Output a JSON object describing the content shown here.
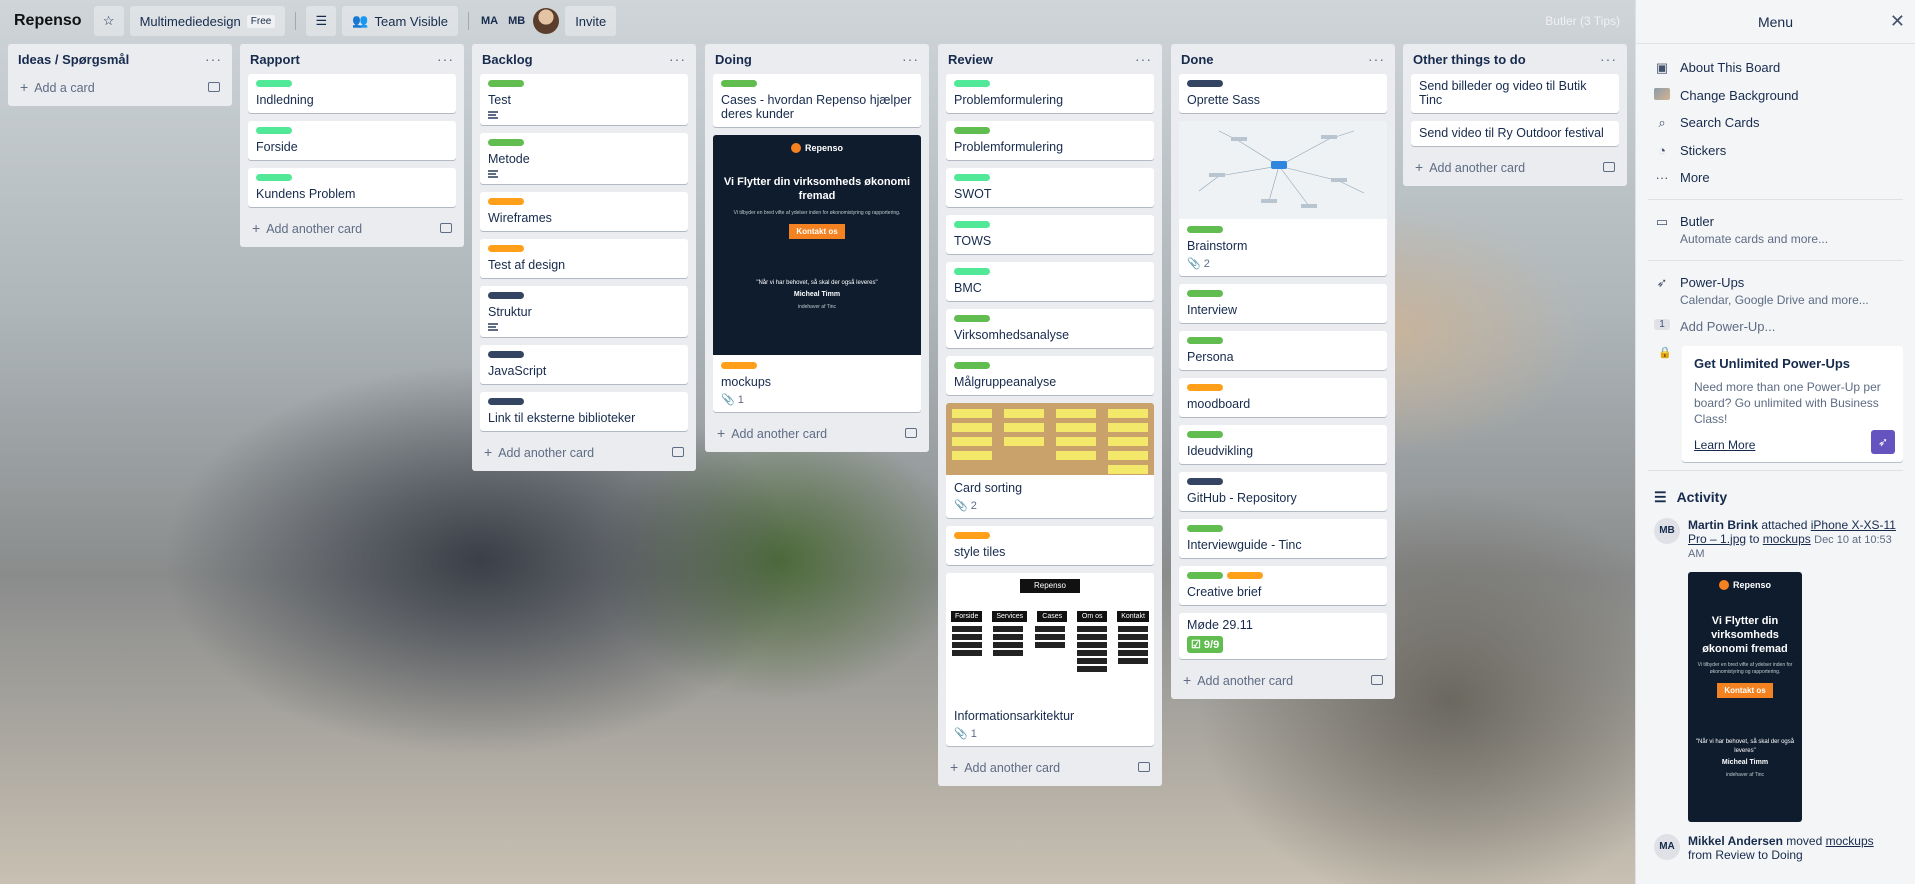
{
  "header": {
    "board_name": "Repenso",
    "team": "Multimediedesign",
    "team_badge": "Free",
    "visibility": "Team Visible",
    "members": [
      "MA",
      "MB"
    ],
    "invite": "Invite",
    "tips": "Butler (3 Tips)"
  },
  "lists": [
    {
      "title": "Ideas / Spørgsmål",
      "add": "Add a card",
      "cards": []
    },
    {
      "title": "Rapport",
      "add": "Add another card",
      "cards": [
        {
          "labels": [
            "teal"
          ],
          "title": "Indledning"
        },
        {
          "labels": [
            "teal"
          ],
          "title": "Forside"
        },
        {
          "labels": [
            "teal"
          ],
          "title": "Kundens Problem"
        }
      ]
    },
    {
      "title": "Backlog",
      "add": "Add another card",
      "cards": [
        {
          "labels": [
            "green"
          ],
          "title": "Test",
          "desc": true
        },
        {
          "labels": [
            "green"
          ],
          "title": "Metode",
          "desc": true
        },
        {
          "labels": [
            "orange"
          ],
          "title": "Wireframes"
        },
        {
          "labels": [
            "orange"
          ],
          "title": "Test af design"
        },
        {
          "labels": [
            "navy"
          ],
          "title": "Struktur",
          "desc": true
        },
        {
          "labels": [
            "navy"
          ],
          "title": "JavaScript"
        },
        {
          "labels": [
            "navy"
          ],
          "title": "Link til eksterne biblioteker"
        }
      ]
    },
    {
      "title": "Doing",
      "add": "Add another card",
      "cards": [
        {
          "labels": [
            "green"
          ],
          "title": "Cases - hvordan Repenso hjælper deres kunder"
        },
        {
          "labels": [
            "orange"
          ],
          "title": "mockups",
          "attach": "1",
          "cover": "mock"
        }
      ]
    },
    {
      "title": "Review",
      "add": "Add another card",
      "cards": [
        {
          "labels": [
            "teal"
          ],
          "title": "Problemformulering"
        },
        {
          "labels": [
            "green"
          ],
          "title": "Problemformulering"
        },
        {
          "labels": [
            "teal"
          ],
          "title": "SWOT"
        },
        {
          "labels": [
            "teal"
          ],
          "title": "TOWS"
        },
        {
          "labels": [
            "teal"
          ],
          "title": "BMC"
        },
        {
          "labels": [
            "green"
          ],
          "title": "Virksomhedsanalyse"
        },
        {
          "labels": [
            "green"
          ],
          "title": "Målgruppeanalyse"
        },
        {
          "labels": [],
          "title": "Card sorting",
          "attach": "2",
          "cover": "cork"
        },
        {
          "labels": [
            "orange"
          ],
          "title": "style tiles"
        },
        {
          "labels": [],
          "title": "Informationsarkitektur",
          "attach": "1",
          "cover": "ia"
        }
      ]
    },
    {
      "title": "Done",
      "add": "Add another card",
      "cards": [
        {
          "labels": [
            "navy"
          ],
          "title": "Oprette Sass"
        },
        {
          "labels": [
            "green"
          ],
          "title": "Brainstorm",
          "attach": "2",
          "cover": "mind"
        },
        {
          "labels": [
            "green"
          ],
          "title": "Interview"
        },
        {
          "labels": [
            "green"
          ],
          "title": "Persona"
        },
        {
          "labels": [
            "orange"
          ],
          "title": "moodboard"
        },
        {
          "labels": [
            "green"
          ],
          "title": "Ideudvikling"
        },
        {
          "labels": [
            "navy"
          ],
          "title": "GitHub - Repository"
        },
        {
          "labels": [
            "green"
          ],
          "title": "Interviewguide - Tinc"
        },
        {
          "labels": [
            "green",
            "orange"
          ],
          "title": "Creative brief"
        },
        {
          "labels": [],
          "title": "Møde 29.11",
          "check": "9/9"
        }
      ]
    },
    {
      "title": "Other things to do",
      "add": "Add another card",
      "cards": [
        {
          "labels": [],
          "title": "Send billeder og video til Butik Tinc"
        },
        {
          "labels": [],
          "title": "Send video til Ry Outdoor festival"
        }
      ]
    }
  ],
  "mockup": {
    "brand": "Repenso",
    "headline": "Vi Flytter din virksomheds økonomi fremad",
    "sub": "Vi tilbyder en bred vifte af ydelser inden for økonomistyring og rapportering.",
    "cta": "Kontakt os",
    "quote": "\"Når vi har behovet, så skal der også leveres\"",
    "who": "Micheal Timm",
    "who_sub": "indehaver af Tinc"
  },
  "ia": {
    "top": "Repenso",
    "nav": [
      "Forside",
      "Services",
      "Cases",
      "Om os",
      "Kontakt"
    ]
  },
  "menu": {
    "title": "Menu",
    "items": [
      {
        "label": "About This Board",
        "icon": "board-icon"
      },
      {
        "label": "Change Background",
        "icon": "background-icon"
      },
      {
        "label": "Search Cards",
        "icon": "search-icon"
      },
      {
        "label": "Stickers",
        "icon": "sticker-icon"
      },
      {
        "label": "More",
        "icon": "more-icon"
      }
    ],
    "butler": {
      "title": "Butler",
      "sub": "Automate cards and more..."
    },
    "powerups": {
      "title": "Power-Ups",
      "sub": "Calendar, Google Drive and more...",
      "count": "1",
      "add": "Add Power-Up..."
    },
    "promo": {
      "title": "Get Unlimited Power-Ups",
      "text": "Need more than one Power-Up per board? Go unlimited with Business Class!",
      "link": "Learn More"
    },
    "activity": {
      "title": "Activity",
      "entries": [
        {
          "avatar": "MB",
          "user": "Martin Brink",
          "action": "attached",
          "object": "iPhone X-XS-11 Pro – 1.jpg",
          "to": "to",
          "card": "mockups",
          "time": "Dec 10 at 10:53 AM"
        },
        {
          "avatar": "MA",
          "user": "Mikkel Andersen",
          "action": "moved",
          "card": "mockups",
          "rest": "from",
          "detail": "Review to Doing"
        }
      ]
    }
  },
  "colors": {
    "green": "#61bd4f",
    "orange": "#ff9f1a",
    "navy": "#344563",
    "teal": "#51e898",
    "list_bg": "#ebecf0"
  }
}
